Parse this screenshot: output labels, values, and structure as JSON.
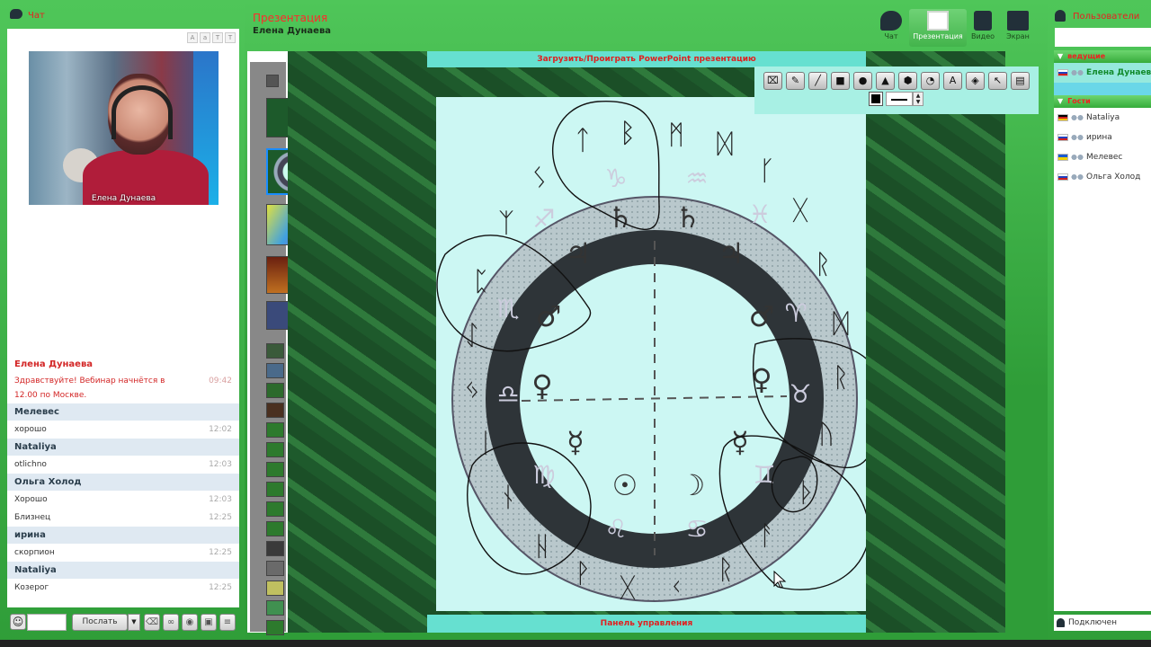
{
  "chat": {
    "title": "Чат",
    "video_caption": "Елена Дунаева",
    "messages": [
      {
        "name": "Елена Дунаева",
        "is_host": true,
        "lines": [
          {
            "text": "Здравствуйте! Вебинар начнётся в 12.00 по Москве.",
            "time": "09:42"
          }
        ]
      },
      {
        "name": "Мелевес",
        "lines": [
          {
            "text": "хорошо",
            "time": "12:02"
          }
        ]
      },
      {
        "name": "Nataliya",
        "lines": [
          {
            "text": "otlichno",
            "time": "12:03"
          }
        ]
      },
      {
        "name": "Ольга Холод",
        "lines": [
          {
            "text": "Хорошо",
            "time": "12:03"
          },
          {
            "text": "Близнец",
            "time": "12:25"
          }
        ]
      },
      {
        "name": "ирина",
        "lines": [
          {
            "text": "скорпион",
            "time": "12:25"
          }
        ]
      },
      {
        "name": "Nataliya",
        "lines": [
          {
            "text": "Козерог",
            "time": "12:25"
          }
        ]
      }
    ],
    "send_label": "Послать"
  },
  "presentation": {
    "title": "Презентация",
    "presenter": "Елена Дунаева",
    "upload_bar": "Загрузить/Проиграть PowerPoint презентацию",
    "control_bar": "Панель управления",
    "nav": [
      {
        "label": "Чат",
        "icon": "chat-bubble-icon"
      },
      {
        "label": "Презентация",
        "icon": "presentation-board-icon",
        "active": true
      },
      {
        "label": "Видео",
        "icon": "video-camera-icon"
      },
      {
        "label": "Экран",
        "icon": "screen-share-icon"
      }
    ],
    "thumbnail_badges": [
      "3",
      "4",
      "5",
      "6",
      "7"
    ],
    "selected_slide": "4"
  },
  "users": {
    "title": "Пользователи",
    "groups": [
      {
        "label": "ведущие",
        "members": [
          {
            "name": "Елена Дунаева",
            "flag": "ru"
          }
        ]
      },
      {
        "label": "Гости",
        "members": [
          {
            "name": "Nataliya",
            "flag": "de"
          },
          {
            "name": "ирина",
            "flag": "ru"
          },
          {
            "name": "Мелевес",
            "flag": "ua"
          },
          {
            "name": "Ольга Холод",
            "flag": "ru"
          }
        ]
      }
    ],
    "footer": "Подключен"
  },
  "colors": {
    "accent_green": "#2fa33a",
    "title_red": "#e82020",
    "highlight_cyan": "#66e0d0"
  }
}
